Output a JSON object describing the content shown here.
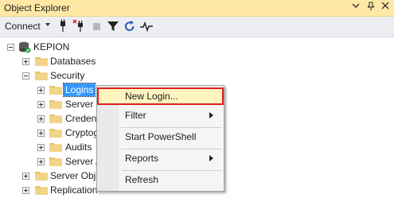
{
  "window": {
    "title": "Object Explorer",
    "controls": [
      "▾",
      "📌",
      "✕"
    ]
  },
  "toolbar": {
    "connect_label": "Connect",
    "connect_caret": "▾",
    "icons": [
      "connect-plug-icon",
      "disconnect-plug-icon",
      "stop-icon",
      "filter-icon",
      "refresh-icon",
      "activity-monitor-icon"
    ]
  },
  "tree": {
    "server": "KEPION",
    "databases": "Databases",
    "security": "Security",
    "logins": "Logins",
    "server_roles": "Server R",
    "credentials": "Credenti",
    "cryptographic": "Cryptog",
    "audits": "Audits",
    "server_audit_spec": "Server A",
    "server_objects": "Server Obje",
    "replication": "Replication"
  },
  "context_menu": {
    "items": [
      {
        "label": "New Login...",
        "submenu": false
      },
      {
        "label": "Filter",
        "submenu": true
      },
      {
        "label": "Start PowerShell",
        "submenu": false
      },
      {
        "label": "Reports",
        "submenu": true
      },
      {
        "label": "Refresh",
        "submenu": false
      }
    ],
    "submenu_arrow": "▶"
  },
  "colors": {
    "titlebar_bg": "#ffe8a6",
    "selection": "#3399ff",
    "highlight_border": "#e02020",
    "highlight_bg": "#fdf4bf"
  }
}
